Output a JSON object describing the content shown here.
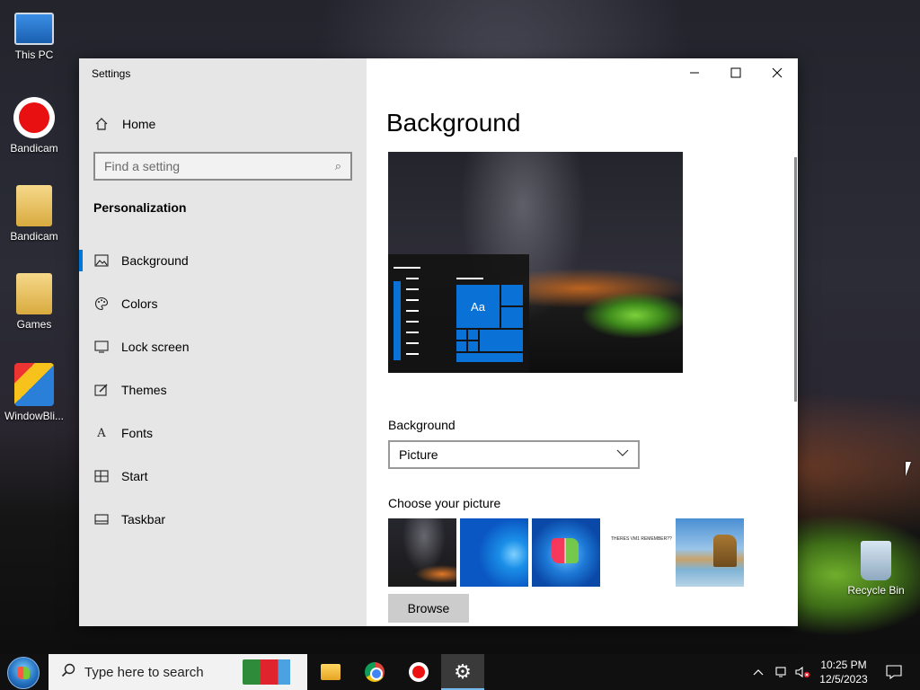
{
  "desktop": {
    "icons": [
      {
        "label": "This PC",
        "icon": "this-pc-icon"
      },
      {
        "label": "Bandicam",
        "icon": "bandicam-icon"
      },
      {
        "label": "Bandicam",
        "icon": "folder-icon"
      },
      {
        "label": "Games",
        "icon": "folder-icon"
      },
      {
        "label": "WindowBli...",
        "icon": "windowblinds-icon"
      },
      {
        "label": "Recycle Bin",
        "icon": "recycle-bin-icon"
      }
    ]
  },
  "window": {
    "title": "Settings",
    "controls": {
      "minimize": "—",
      "maximize": "☐",
      "close": "✕"
    }
  },
  "sidebar": {
    "home_label": "Home",
    "search_placeholder": "Find a setting",
    "section_title": "Personalization",
    "items": [
      {
        "label": "Background",
        "icon": "picture-icon",
        "active": true
      },
      {
        "label": "Colors",
        "icon": "palette-icon",
        "active": false
      },
      {
        "label": "Lock screen",
        "icon": "lock-screen-icon",
        "active": false
      },
      {
        "label": "Themes",
        "icon": "themes-icon",
        "active": false
      },
      {
        "label": "Fonts",
        "icon": "fonts-icon",
        "active": false
      },
      {
        "label": "Start",
        "icon": "start-icon",
        "active": false
      },
      {
        "label": "Taskbar",
        "icon": "taskbar-icon",
        "active": false
      }
    ]
  },
  "main": {
    "title": "Background",
    "preview_tile_text": "Aa",
    "background_label": "Background",
    "background_value": "Picture",
    "choose_label": "Choose your picture",
    "thumbnail_text": "THERES VM1 REMEMBER??",
    "browse_label": "Browse"
  },
  "taskbar": {
    "search_placeholder": "Type here to search",
    "time": "10:25 PM",
    "date": "12/5/2023",
    "apps": [
      "file-explorer-icon",
      "chrome-icon",
      "bandicam-icon",
      "settings-icon"
    ]
  },
  "colors": {
    "accent": "#0078d7",
    "sidebar_bg": "#e6e6e6",
    "taskbar_bg": "#101010"
  }
}
